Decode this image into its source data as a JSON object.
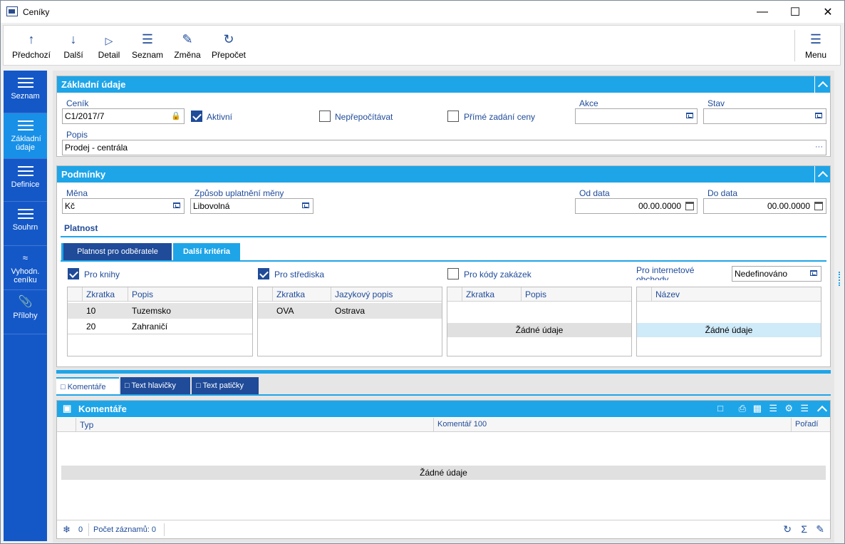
{
  "window": {
    "title": "Ceníky"
  },
  "toolbar": {
    "prev": "Předchozí",
    "next": "Další",
    "detail": "Detail",
    "list": "Seznam",
    "change": "Změna",
    "recalc": "Přepočet",
    "menu": "Menu"
  },
  "sidebar": {
    "items": [
      {
        "label": "Seznam"
      },
      {
        "label": "Základní údaje"
      },
      {
        "label": "Definice"
      },
      {
        "label": "Souhrn"
      },
      {
        "label": "Vyhodn. ceníku"
      },
      {
        "label": "Přílohy"
      }
    ]
  },
  "basic": {
    "header": "Základní údaje",
    "pricelist_label": "Ceník",
    "pricelist_value": "C1/2017/7",
    "active_label": "Aktivní",
    "no_recalc_label": "Nepřepočítávat",
    "direct_price_label": "Přímé zadání ceny",
    "action_label": "Akce",
    "action_value": "",
    "state_label": "Stav",
    "state_value": "",
    "desc_label": "Popis",
    "desc_value": "Prodej - centrála",
    "ellipsis": "···"
  },
  "conditions": {
    "header": "Podmínky",
    "currency_label": "Měna",
    "currency_value": "Kč",
    "mode_label": "Způsob uplatnění měny",
    "mode_value": "Libovolná",
    "from_label": "Od data",
    "from_value": "00.00.0000",
    "to_label": "Do data",
    "to_value": "00.00.0000",
    "validity": "Platnost",
    "tabs": [
      "Platnost pro odběratele",
      "Další kritéria"
    ],
    "books_label": "Pro knihy",
    "centers_label": "Pro střediska",
    "orders_label": "Pro kódy zakázek",
    "eshop_label": "Pro internetové obchody",
    "eshop_value": "Nedefinováno",
    "books_grid": {
      "cols": [
        "Zkratka",
        "Popis"
      ],
      "rows": [
        [
          "10",
          "Tuzemsko"
        ],
        [
          "20",
          "Zahraničí"
        ]
      ]
    },
    "centers_grid": {
      "cols": [
        "Zkratka",
        "Jazykový popis"
      ],
      "rows": [
        [
          "OVA",
          "Ostrava"
        ]
      ]
    },
    "orders_grid": {
      "cols": [
        "Zkratka",
        "Popis"
      ],
      "empty": "Žádné údaje"
    },
    "eshop_grid": {
      "cols": [
        "Název"
      ],
      "empty": "Žádné údaje"
    }
  },
  "bottom": {
    "tabs": [
      "Komentáře",
      "Text hlavičky",
      "Text patičky"
    ],
    "header": "Komentáře",
    "cols": [
      "Typ",
      "Komentář 100",
      "Pořadí"
    ],
    "empty": "Žádné údaje",
    "count_icon_value": "0",
    "records": "Počet záznamů: 0"
  }
}
